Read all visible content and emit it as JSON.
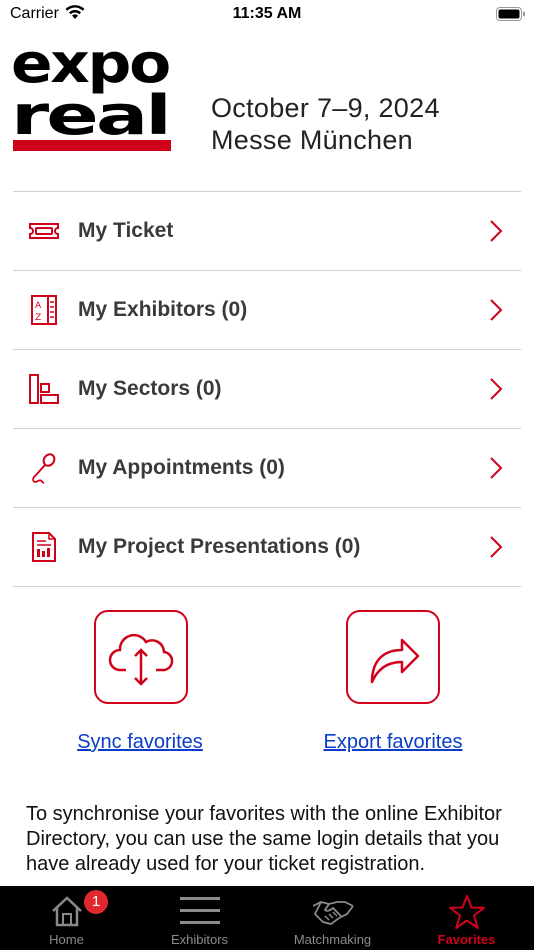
{
  "status_bar": {
    "carrier": "Carrier",
    "time": "11:35 AM"
  },
  "header": {
    "logo_lines": [
      "expo",
      "real"
    ],
    "event_date": "October 7–9, 2024",
    "event_venue": "Messe München"
  },
  "menu": [
    {
      "label": "My Ticket",
      "icon": "ticket-icon"
    },
    {
      "label": "My Exhibitors (0)",
      "icon": "az-list-icon"
    },
    {
      "label": "My Sectors (0)",
      "icon": "sectors-icon"
    },
    {
      "label": "My Appointments (0)",
      "icon": "microphone-icon"
    },
    {
      "label": "My Project Presentations (0)",
      "icon": "document-icon"
    }
  ],
  "actions": {
    "sync_label": "Sync favorites",
    "export_label": "Export favorites"
  },
  "info_text": "To synchronise your favorites with the online Exhibitor Directory, you can use the same login details that you have already used for your ticket registration.",
  "tab_bar": {
    "tabs": [
      {
        "label": "Home",
        "icon": "home-icon"
      },
      {
        "label": "Exhibitors",
        "icon": "menu-lines-icon"
      },
      {
        "label": "Matchmaking",
        "icon": "handshake-icon"
      },
      {
        "label": "Favorites",
        "icon": "star-icon"
      }
    ],
    "active_tab": "Favorites",
    "home_badge": "1"
  },
  "colors": {
    "accent": "#d0021b",
    "link": "#0a3cc9",
    "tab_bar_bg": "#000000",
    "divider": "#cfcfcf"
  }
}
